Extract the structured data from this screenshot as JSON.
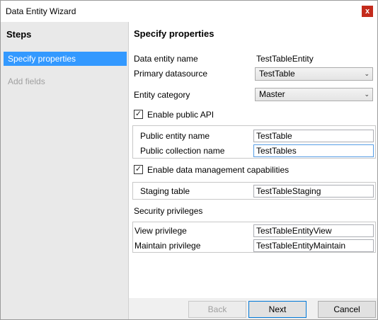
{
  "window": {
    "title": "Data Entity Wizard",
    "close_glyph": "x"
  },
  "sidebar": {
    "title": "Steps",
    "steps": [
      {
        "label": "Specify properties",
        "state": "active"
      },
      {
        "label": "Add fields",
        "state": "disabled"
      }
    ]
  },
  "main": {
    "title": "Specify properties",
    "data_entity_name_label": "Data entity name",
    "data_entity_name_value": "TestTableEntity",
    "primary_datasource_label": "Primary datasource",
    "primary_datasource_value": "TestTable",
    "entity_category_label": "Entity category",
    "entity_category_value": "Master",
    "enable_public_api_label": "Enable public API",
    "enable_public_api_checked": true,
    "public_entity_name_label": "Public entity name",
    "public_entity_name_value": "TestTable",
    "public_collection_name_label": "Public collection name",
    "public_collection_name_value": "TestTables",
    "enable_dm_label": "Enable data management capabilities",
    "enable_dm_checked": true,
    "staging_table_label": "Staging table",
    "staging_table_value": "TestTableStaging",
    "security_privileges_label": "Security privileges",
    "view_privilege_label": "View privilege",
    "view_privilege_value": "TestTableEntityView",
    "maintain_privilege_label": "Maintain privilege",
    "maintain_privilege_value": "TestTableEntityMaintain"
  },
  "footer": {
    "back_label": "Back",
    "next_label": "Next",
    "cancel_label": "Cancel"
  },
  "icons": {
    "check": "✓",
    "dropdown": "⌄"
  },
  "colors": {
    "accent": "#3399ff",
    "close": "#c42b1c"
  }
}
